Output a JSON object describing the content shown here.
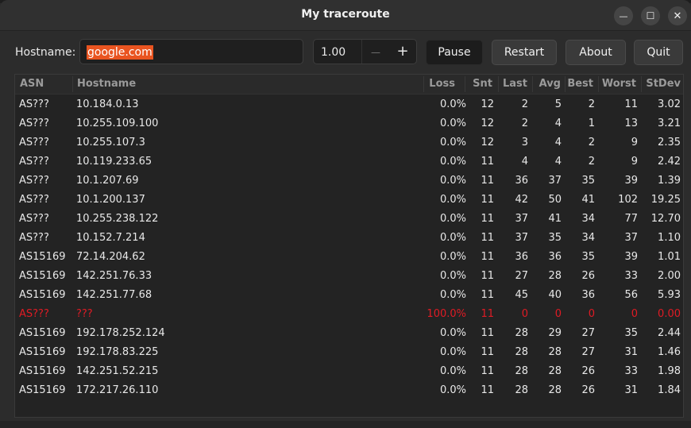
{
  "window": {
    "title": "My traceroute",
    "minimize_label": "—",
    "maximize_label": "☐",
    "close_label": "✕"
  },
  "toolbar": {
    "hostname_label": "Hostname:",
    "hostname_value": "google.com",
    "interval_value": "1.00",
    "decrement_label": "—",
    "increment_label": "+",
    "pause_label": "Pause",
    "restart_label": "Restart",
    "about_label": "About",
    "quit_label": "Quit"
  },
  "table": {
    "columns": [
      "ASN",
      "Hostname",
      "Loss",
      "Snt",
      "Last",
      "Avg",
      "Best",
      "Worst",
      "StDev"
    ],
    "error_color": "#e01b24",
    "rows": [
      [
        "AS???",
        "10.184.0.13",
        "0.0%",
        "12",
        "2",
        "5",
        "2",
        "11",
        "3.02"
      ],
      [
        "AS???",
        "10.255.109.100",
        "0.0%",
        "12",
        "2",
        "4",
        "1",
        "13",
        "3.21"
      ],
      [
        "AS???",
        "10.255.107.3",
        "0.0%",
        "12",
        "3",
        "4",
        "2",
        "9",
        "2.35"
      ],
      [
        "AS???",
        "10.119.233.65",
        "0.0%",
        "11",
        "4",
        "4",
        "2",
        "9",
        "2.42"
      ],
      [
        "AS???",
        "10.1.207.69",
        "0.0%",
        "11",
        "36",
        "37",
        "35",
        "39",
        "1.39"
      ],
      [
        "AS???",
        "10.1.200.137",
        "0.0%",
        "11",
        "42",
        "50",
        "41",
        "102",
        "19.25"
      ],
      [
        "AS???",
        "10.255.238.122",
        "0.0%",
        "11",
        "37",
        "41",
        "34",
        "77",
        "12.70"
      ],
      [
        "AS???",
        "10.152.7.214",
        "0.0%",
        "11",
        "37",
        "35",
        "34",
        "37",
        "1.10"
      ],
      [
        "AS15169",
        "72.14.204.62",
        "0.0%",
        "11",
        "36",
        "36",
        "35",
        "39",
        "1.01"
      ],
      [
        "AS15169",
        "142.251.76.33",
        "0.0%",
        "11",
        "27",
        "28",
        "26",
        "33",
        "2.00"
      ],
      [
        "AS15169",
        "142.251.77.68",
        "0.0%",
        "11",
        "45",
        "40",
        "36",
        "56",
        "5.93"
      ],
      [
        "AS???",
        "???",
        "100.0%",
        "11",
        "0",
        "0",
        "0",
        "0",
        "0.00"
      ],
      [
        "AS15169",
        "192.178.252.124",
        "0.0%",
        "11",
        "28",
        "29",
        "27",
        "35",
        "2.44"
      ],
      [
        "AS15169",
        "192.178.83.225",
        "0.0%",
        "11",
        "28",
        "28",
        "27",
        "31",
        "1.46"
      ],
      [
        "AS15169",
        "142.251.52.215",
        "0.0%",
        "11",
        "28",
        "28",
        "26",
        "33",
        "1.98"
      ],
      [
        "AS15169",
        "172.217.26.110",
        "0.0%",
        "11",
        "28",
        "28",
        "26",
        "31",
        "1.84"
      ]
    ]
  }
}
